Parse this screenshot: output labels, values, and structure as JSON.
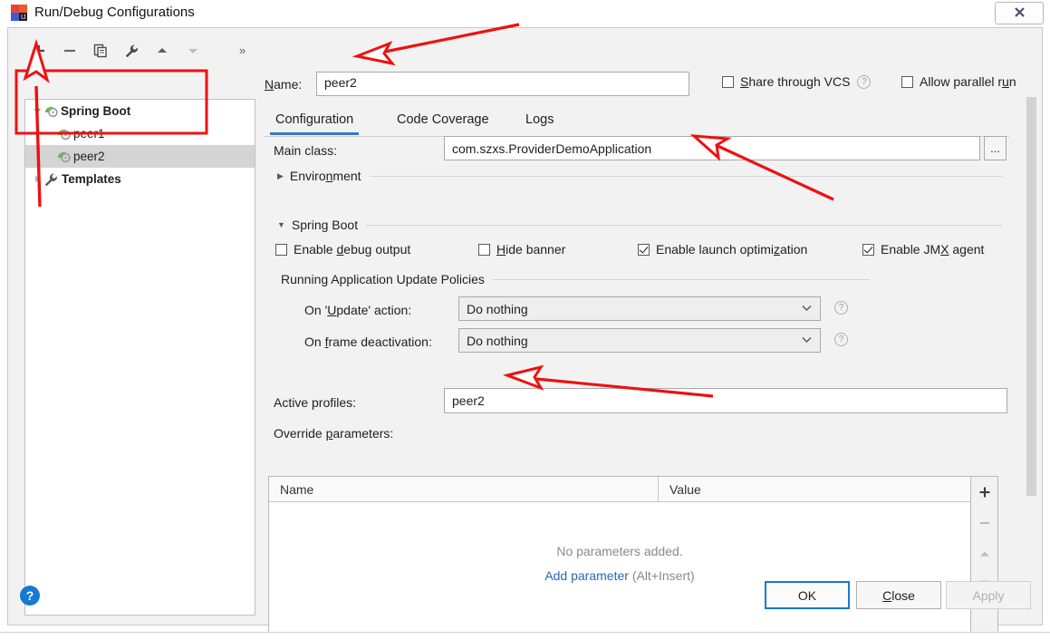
{
  "window": {
    "title": "Run/Debug Configurations",
    "close_label": "✕",
    "app_icon": "intellij-idea-icon"
  },
  "toolbar": {
    "add_label": "+",
    "remove_label": "−",
    "copy_label": "copy",
    "edit_templates_label": "wrench",
    "move_up_label": "▲",
    "move_down_label": "▼",
    "more_label": "»"
  },
  "tree": {
    "nodes": [
      {
        "label": "Spring Boot",
        "icon": "spring-boot-icon",
        "expanded": true,
        "bold": true,
        "selected": false,
        "level": 0
      },
      {
        "label": "peer1",
        "icon": "spring-boot-icon",
        "bold": false,
        "selected": false,
        "level": 1
      },
      {
        "label": "peer2",
        "icon": "spring-boot-icon",
        "bold": false,
        "selected": true,
        "level": 1
      },
      {
        "label": "Templates",
        "icon": "wrench-icon",
        "expanded": false,
        "bold": true,
        "selected": false,
        "level": 0
      }
    ]
  },
  "name_row": {
    "label": "Name:",
    "label_mnemonic": "N",
    "value": "peer2",
    "share_vcs": {
      "label": "Share through VCS",
      "mnemonic": "S",
      "checked": false,
      "help": "?"
    },
    "allow_parallel": {
      "label": "Allow parallel run",
      "mnemonic": "u",
      "checked": false
    }
  },
  "tabs": [
    {
      "label": "Configuration",
      "active": true
    },
    {
      "label": "Code Coverage",
      "active": false
    },
    {
      "label": "Logs",
      "active": false
    }
  ],
  "configuration": {
    "main_class": {
      "label": "Main class:",
      "value": "com.szxs.ProviderDemoApplication",
      "browse_label": "..."
    },
    "environment_section": {
      "title": "Environment",
      "mnemonic": "n",
      "expanded": false,
      "triangle": "▶"
    },
    "spring_boot_section": {
      "title": "Spring Boot",
      "mnemonic": "g",
      "expanded": true,
      "triangle": "▼",
      "checkboxes": [
        {
          "label": "Enable debug output",
          "mnemonic": "d",
          "checked": false
        },
        {
          "label": "Hide banner",
          "mnemonic": "H",
          "checked": false
        },
        {
          "label": "Enable launch optimization",
          "mnemonic": "z",
          "checked": true
        },
        {
          "label": "Enable JMX agent",
          "mnemonic": "X",
          "checked": true
        }
      ]
    },
    "update_policies": {
      "title": "Running Application Update Policies",
      "rows": [
        {
          "label": "On 'Update' action:",
          "mnemonic": "U",
          "value": "Do nothing",
          "help": "?"
        },
        {
          "label": "On frame deactivation:",
          "mnemonic": "f",
          "value": "Do nothing",
          "help": "?"
        }
      ]
    },
    "active_profiles": {
      "label": "Active profiles:",
      "value": "peer2"
    },
    "override_parameters": {
      "label": "Override parameters:",
      "mnemonic": "p",
      "columns": [
        "Name",
        "Value"
      ],
      "rows": [],
      "empty_message": "No parameters added.",
      "add_link": "Add parameter",
      "add_hint": "(Alt+Insert)",
      "side_buttons": [
        "+",
        "−",
        "▲",
        "▼"
      ]
    }
  },
  "footer": {
    "help_label": "?",
    "ok_label": "OK",
    "close_label": "Close",
    "close_mnemonic": "C",
    "apply_label": "Apply",
    "apply_enabled": false
  },
  "annotations": {
    "color": "#ee1111",
    "highlight_box_label": "spring-boot-configs-highlight",
    "arrows": [
      "arrow-to-add-button",
      "arrow-to-name-field",
      "arrow-to-main-class-field",
      "arrow-to-active-profiles-field"
    ]
  }
}
